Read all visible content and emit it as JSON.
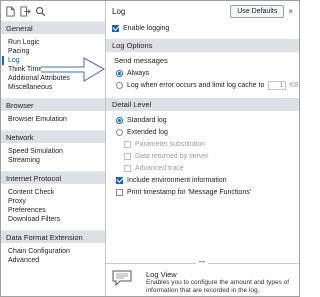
{
  "toolbar": {
    "icons": [
      "document-icon",
      "import-icon",
      "search-icon"
    ]
  },
  "nav": {
    "sections": [
      {
        "header": "General",
        "items": [
          "Run Logic",
          "Pacing",
          "Log",
          "Think Time",
          "Additional Attributes",
          "Miscellaneous"
        ]
      },
      {
        "header": "Browser",
        "items": [
          "Browser Emulation"
        ]
      },
      {
        "header": "Network",
        "items": [
          "Speed Simulation",
          "Streaming"
        ]
      },
      {
        "header": "Internet Protocol",
        "items": [
          "Content Check",
          "Proxy",
          "Preferences",
          "Download Filters"
        ]
      },
      {
        "header": "Data Format Extension",
        "items": [
          "Chain Configuration",
          "Advanced"
        ]
      }
    ],
    "active_item": "Log"
  },
  "panel": {
    "title": "Log",
    "use_defaults_label": "Use Defaults",
    "close_label": "×",
    "enable_logging": {
      "label": "Enable logging",
      "checked": true
    },
    "log_options_header": "Log Options",
    "send_messages_label": "Send messages",
    "always_label": "Always",
    "on_error_label": "Log when error occurs and limit log cache to",
    "cache_value": "1",
    "cache_unit": "KB",
    "detail_level_header": "Detail Level",
    "standard_log_label": "Standard log",
    "extended_log_label": "Extended log",
    "param_sub_label": "Parameter substitution",
    "data_returned_label": "Data returned by server",
    "advanced_trace_label": "Advanced trace",
    "env_info_label": "Include environment information",
    "print_timestamp_label": "Print timestamp for 'Message Functions'"
  },
  "help": {
    "handle": "•••",
    "title": "Log View",
    "description": "Enables you to configure the amount and types of information that are recorded in the log."
  },
  "colors": {
    "accent": "#1565c0",
    "section_bg": "#dde1e6",
    "arrow_stroke": "#3b6fb6"
  }
}
